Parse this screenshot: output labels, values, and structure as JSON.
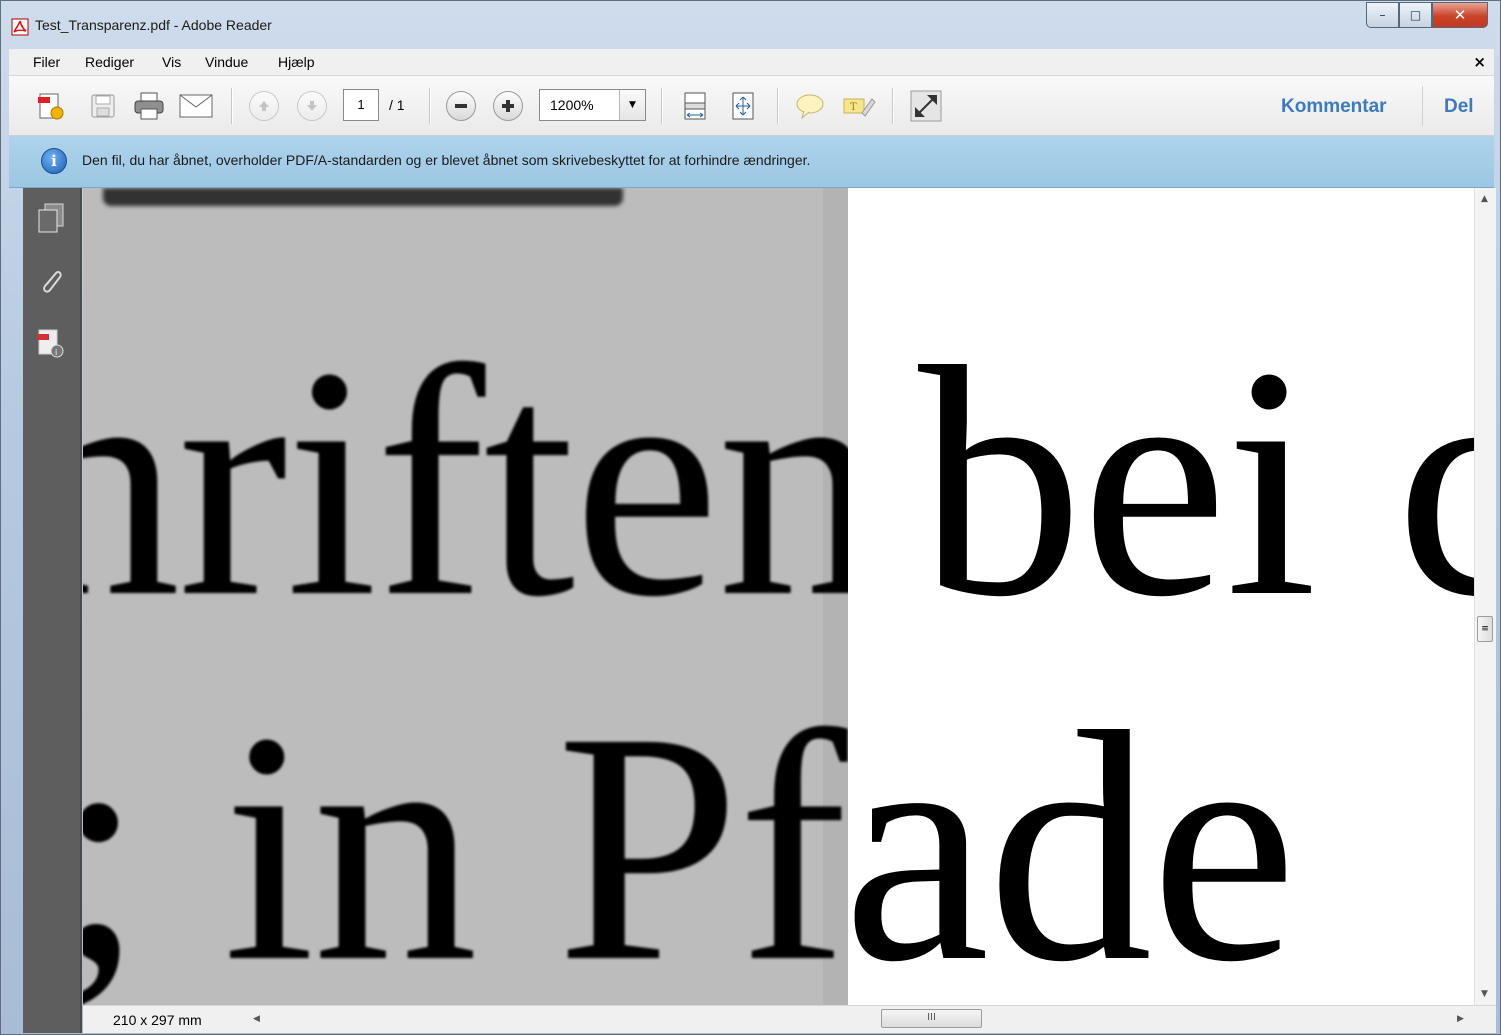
{
  "window": {
    "title": "Test_Transparenz.pdf - Adobe Reader",
    "minimize": "–",
    "maximize": "□",
    "close": "✕"
  },
  "menu": {
    "items": [
      "Filer",
      "Rediger",
      "Vis",
      "Vindue",
      "Hjælp"
    ],
    "close": "×"
  },
  "toolbar": {
    "page_current": "1",
    "page_total": "/ 1",
    "zoom": "1200%",
    "comment_label": "Kommentar",
    "share_label": "Del"
  },
  "infobar": {
    "icon": "info-icon",
    "message": "Den fil, du har åbnet, overholder PDF/A-standarden og er blevet åbnet som skrivebeskyttet for at forhindre ændringer."
  },
  "document": {
    "line1_left": "hriften",
    "line1_right": "bei c",
    "line2_left": "; in Pfa",
    "line2_right": "ade",
    "colors": {
      "raster_bg": "#bcbcbc",
      "page_bg": "#ffffff"
    }
  },
  "status": {
    "page_size": "210 x 297 mm",
    "hscroll_grip": "III",
    "vscroll_grip": "≡"
  }
}
